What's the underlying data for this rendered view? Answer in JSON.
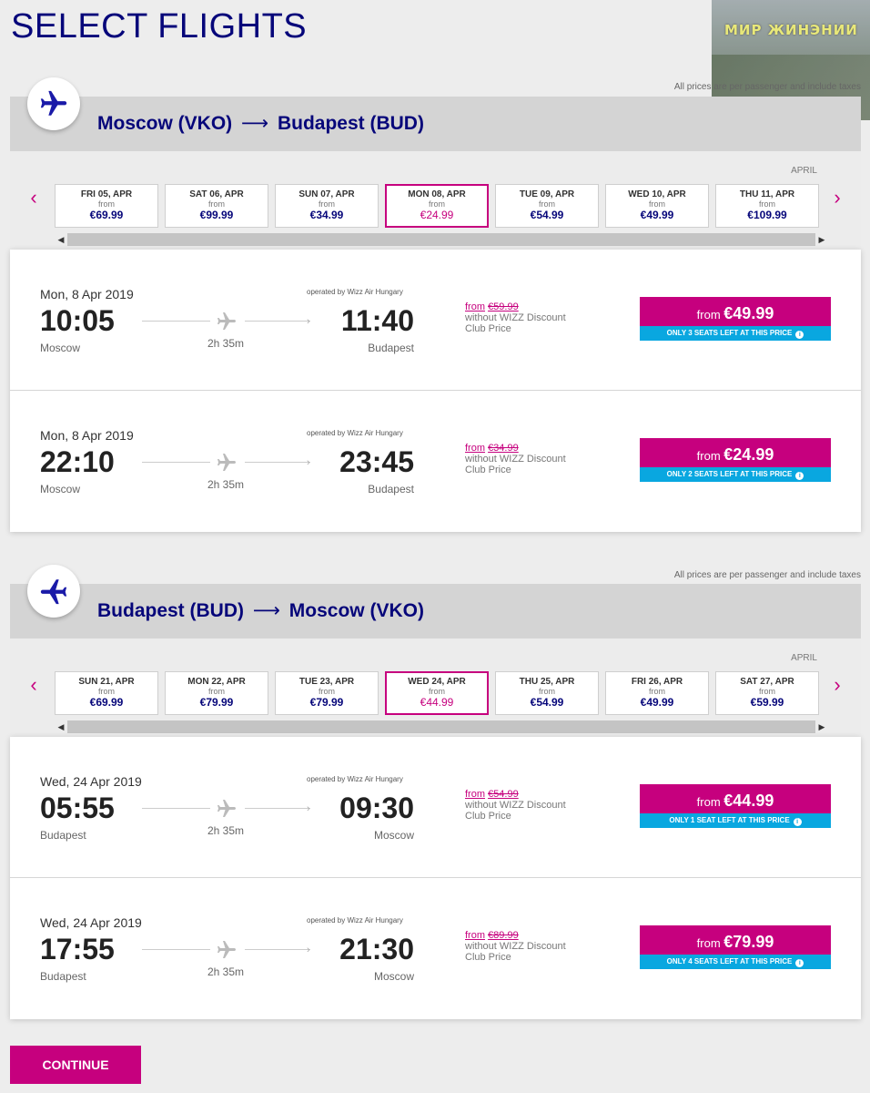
{
  "page": {
    "title": "SELECT FLIGHTS",
    "continue_label": "CONTINUE",
    "watermark_text": "МИР ЖИНЭНИИ"
  },
  "colors": {
    "brand_navy": "#06067a",
    "brand_magenta": "#c6007e",
    "seats_blue": "#09a7e0"
  },
  "outbound": {
    "tax_note": "All prices are per passenger and include taxes",
    "route": {
      "from": "Moscow (VKO)",
      "arrow": "⟶",
      "to": "Budapest (BUD)"
    },
    "icon": "plane-icon",
    "month": "APRIL",
    "dates": [
      {
        "day": "FRI 05, APR",
        "from": "from",
        "price": "€69.99"
      },
      {
        "day": "SAT 06, APR",
        "from": "from",
        "price": "€99.99"
      },
      {
        "day": "SUN 07, APR",
        "from": "from",
        "price": "€34.99"
      },
      {
        "day": "MON 08, APR",
        "from": "from",
        "price": "€24.99"
      },
      {
        "day": "TUE 09, APR",
        "from": "from",
        "price": "€54.99"
      },
      {
        "day": "WED 10, APR",
        "from": "from",
        "price": "€49.99"
      },
      {
        "day": "THU 11, APR",
        "from": "from",
        "price": "€109.99"
      }
    ],
    "flights": [
      {
        "date": "Mon, 8 Apr 2019",
        "operated": "operated by Wizz Air Hungary",
        "dep": "10:05",
        "arr": "11:40",
        "from_city": "Moscow",
        "to_city": "Budapest",
        "duration": "2h 35m",
        "club_from": "from",
        "club_price": "€59.99",
        "club_note1": "without WIZZ Discount",
        "club_note2": "Club Price",
        "btn_from": "from",
        "btn_price": "€49.99",
        "seats": "ONLY 3 SEATS LEFT AT THIS PRICE"
      },
      {
        "date": "Mon, 8 Apr 2019",
        "operated": "operated by Wizz Air Hungary",
        "dep": "22:10",
        "arr": "23:45",
        "from_city": "Moscow",
        "to_city": "Budapest",
        "duration": "2h 35m",
        "club_from": "from",
        "club_price": "€34.99",
        "club_note1": "without WIZZ Discount",
        "club_note2": "Club Price",
        "btn_from": "from",
        "btn_price": "€24.99",
        "seats": "ONLY 2 SEATS LEFT AT THIS PRICE"
      }
    ]
  },
  "return": {
    "tax_note": "All prices are per passenger and include taxes",
    "route": {
      "from": "Budapest (BUD)",
      "arrow": "⟶",
      "to": "Moscow (VKO)"
    },
    "icon": "plane-icon",
    "month": "APRIL",
    "dates": [
      {
        "day": "SUN 21, APR",
        "from": "from",
        "price": "€69.99"
      },
      {
        "day": "MON 22, APR",
        "from": "from",
        "price": "€79.99"
      },
      {
        "day": "TUE 23, APR",
        "from": "from",
        "price": "€79.99"
      },
      {
        "day": "WED 24, APR",
        "from": "from",
        "price": "€44.99"
      },
      {
        "day": "THU 25, APR",
        "from": "from",
        "price": "€54.99"
      },
      {
        "day": "FRI 26, APR",
        "from": "from",
        "price": "€49.99"
      },
      {
        "day": "SAT 27, APR",
        "from": "from",
        "price": "€59.99"
      }
    ],
    "flights": [
      {
        "date": "Wed, 24 Apr 2019",
        "operated": "operated by Wizz Air Hungary",
        "dep": "05:55",
        "arr": "09:30",
        "from_city": "Budapest",
        "to_city": "Moscow",
        "duration": "2h 35m",
        "club_from": "from",
        "club_price": "€54.99",
        "club_note1": "without WIZZ Discount",
        "club_note2": "Club Price",
        "btn_from": "from",
        "btn_price": "€44.99",
        "seats": "ONLY 1 SEAT LEFT AT THIS PRICE"
      },
      {
        "date": "Wed, 24 Apr 2019",
        "operated": "operated by Wizz Air Hungary",
        "dep": "17:55",
        "arr": "21:30",
        "from_city": "Budapest",
        "to_city": "Moscow",
        "duration": "2h 35m",
        "club_from": "from",
        "club_price": "€89.99",
        "club_note1": "without WIZZ Discount",
        "club_note2": "Club Price",
        "btn_from": "from",
        "btn_price": "€79.99",
        "seats": "ONLY 4 SEATS LEFT AT THIS PRICE"
      }
    ]
  }
}
